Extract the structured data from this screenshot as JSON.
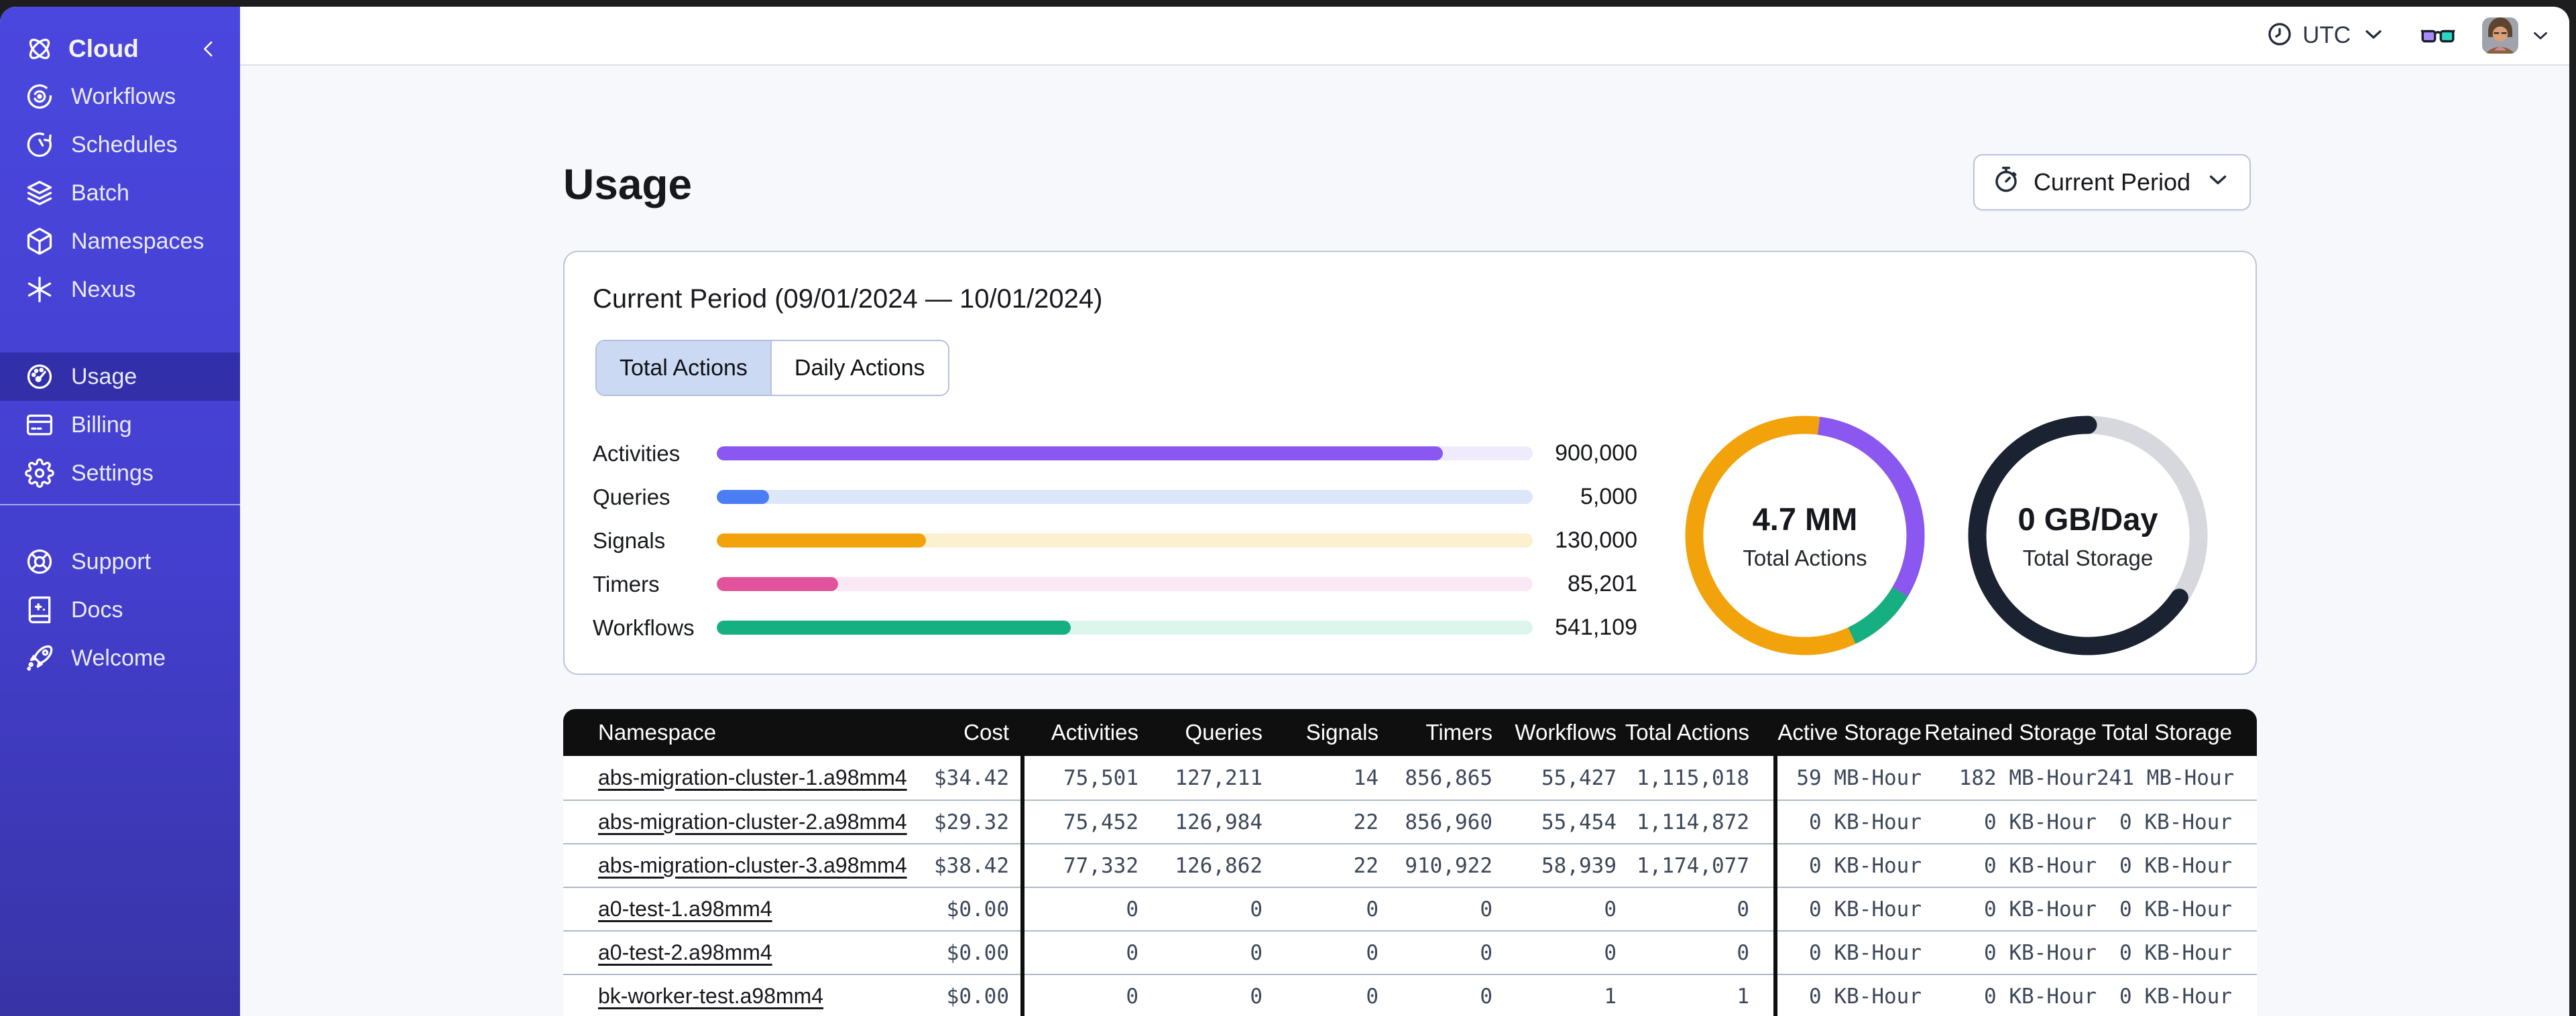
{
  "sidebar": {
    "brand": {
      "label": "Cloud",
      "icon": "temporal-logo-icon"
    },
    "items_top": [
      {
        "label": "Workflows",
        "icon": "workflows-icon",
        "selected": false
      },
      {
        "label": "Schedules",
        "icon": "schedules-icon",
        "selected": false
      },
      {
        "label": "Batch",
        "icon": "batch-icon",
        "selected": false
      },
      {
        "label": "Namespaces",
        "icon": "namespaces-icon",
        "selected": false
      },
      {
        "label": "Nexus",
        "icon": "nexus-icon",
        "selected": false
      }
    ],
    "items_account": [
      {
        "label": "Usage",
        "icon": "usage-icon",
        "selected": true
      },
      {
        "label": "Billing",
        "icon": "billing-icon",
        "selected": false
      },
      {
        "label": "Settings",
        "icon": "settings-icon",
        "selected": false
      }
    ],
    "items_bottom": [
      {
        "label": "Support",
        "icon": "support-icon",
        "selected": false
      },
      {
        "label": "Docs",
        "icon": "docs-icon",
        "selected": false
      },
      {
        "label": "Welcome",
        "icon": "welcome-icon",
        "selected": false
      }
    ]
  },
  "topbar": {
    "timezone": "UTC"
  },
  "page": {
    "title": "Usage",
    "period_button_label": "Current Period"
  },
  "summary_card": {
    "title": "Current Period (09/01/2024 — 10/01/2024)",
    "tabs": [
      {
        "label": "Total Actions",
        "active": true
      },
      {
        "label": "Daily Actions",
        "active": false
      }
    ]
  },
  "chart_data": [
    {
      "type": "bar",
      "orientation": "horizontal",
      "categories": [
        "Activities",
        "Queries",
        "Signals",
        "Timers",
        "Workflows"
      ],
      "values": [
        900000,
        5000,
        130000,
        85201,
        541109
      ],
      "value_labels": [
        "900,000",
        "5,000",
        "130,000",
        "85,201",
        "541,109"
      ],
      "fill_fractions": [
        0.89,
        0.064,
        0.256,
        0.149,
        0.434
      ],
      "bar_colors": [
        "#8A57F0",
        "#4B7EF5",
        "#F2A30B",
        "#E1549B",
        "#16AF82"
      ],
      "track_colors": [
        "#EFEBFC",
        "#DCE7FA",
        "#FBF0CF",
        "#FAE8F5",
        "#DCF6EC"
      ],
      "title": "",
      "xlabel": "",
      "ylabel": "",
      "grid": false,
      "legend": "none"
    },
    {
      "type": "donut",
      "center_value": "4.7 MM",
      "center_label": "Total Actions",
      "base_color": "#F2A30B",
      "arcs": [
        {
          "name": "activities-segment",
          "color": "#8A57F0",
          "start": 0.02,
          "fraction": 0.315,
          "round_cap": false
        },
        {
          "name": "workflows-segment",
          "color": "#16AF82",
          "start": 0.335,
          "fraction": 0.095,
          "round_cap": false
        }
      ]
    },
    {
      "type": "donut",
      "center_value": "0 GB/Day",
      "center_label": "Total Storage",
      "base_color": "#D6D8DD",
      "arcs": [
        {
          "name": "storage-used-segment",
          "color": "#1B2231",
          "start": 0.345,
          "fraction": 0.655,
          "round_cap": true
        }
      ]
    }
  ],
  "usage_table": {
    "columns": [
      "Namespace",
      "Cost",
      "Activities",
      "Queries",
      "Signals",
      "Timers",
      "Workflows",
      "Total Actions",
      "Active Storage",
      "Retained Storage",
      "Total Storage"
    ],
    "rows": [
      [
        "abs-migration-cluster-1.a98mm4",
        "$34.42",
        "75,501",
        "127,211",
        "14",
        "856,865",
        "55,427",
        "1,115,018",
        "59 MB-Hour",
        "182 MB-Hour",
        "241 MB-Hour"
      ],
      [
        "abs-migration-cluster-2.a98mm4",
        "$29.32",
        "75,452",
        "126,984",
        "22",
        "856,960",
        "55,454",
        "1,114,872",
        "0 KB-Hour",
        "0 KB-Hour",
        "0 KB-Hour"
      ],
      [
        "abs-migration-cluster-3.a98mm4",
        "$38.42",
        "77,332",
        "126,862",
        "22",
        "910,922",
        "58,939",
        "1,174,077",
        "0 KB-Hour",
        "0 KB-Hour",
        "0 KB-Hour"
      ],
      [
        "a0-test-1.a98mm4",
        "$0.00",
        "0",
        "0",
        "0",
        "0",
        "0",
        "0",
        "0 KB-Hour",
        "0 KB-Hour",
        "0 KB-Hour"
      ],
      [
        "a0-test-2.a98mm4",
        "$0.00",
        "0",
        "0",
        "0",
        "0",
        "0",
        "0",
        "0 KB-Hour",
        "0 KB-Hour",
        "0 KB-Hour"
      ],
      [
        "bk-worker-test.a98mm4",
        "$0.00",
        "0",
        "0",
        "0",
        "0",
        "1",
        "1",
        "0 KB-Hour",
        "0 KB-Hour",
        "0 KB-Hour"
      ]
    ]
  },
  "colors": {
    "sidebar_top": "#4A47DE",
    "sidebar_bottom": "#3834A6",
    "accent_active_tab": "#CBD9F3",
    "table_header_bg": "#0F0F10",
    "content_bg": "#F7F8FB"
  }
}
